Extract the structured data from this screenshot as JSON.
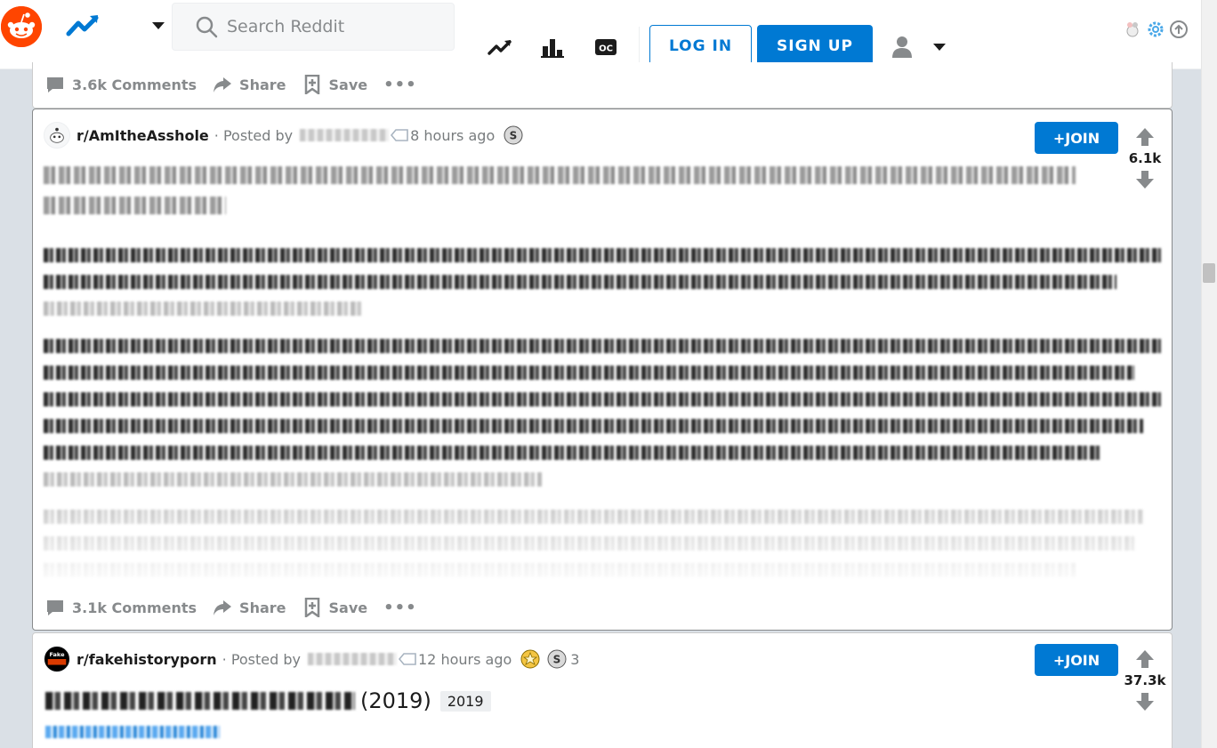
{
  "header": {
    "search_placeholder": "Search Reddit",
    "login_label": "LOG IN",
    "signup_label": "SIGN UP",
    "icons": [
      "reddit-logo",
      "trending-icon",
      "popular-icon",
      "oc-icon",
      "user-icon"
    ]
  },
  "posts": [
    {
      "comments_label": "3.6k Comments",
      "share_label": "Share",
      "save_label": "Save",
      "more_label": "•••"
    },
    {
      "subreddit": "r/AmItheAsshole",
      "posted_by_label": "· Posted by",
      "time": "8 hours ago",
      "join_label": "+JOIN",
      "score": "6.1k",
      "comments_label": "3.1k Comments",
      "share_label": "Share",
      "save_label": "Save",
      "more_label": "•••"
    },
    {
      "subreddit": "r/fakehistoryporn",
      "posted_by_label": "· Posted by",
      "time": "12 hours ago",
      "award_count": "3",
      "join_label": "+JOIN",
      "score": "37.3k",
      "title_suffix": "(2019)",
      "flair": "2019"
    }
  ],
  "colors": {
    "accent": "#0079d3",
    "brand": "#ff4500",
    "page_bg": "#dae0e6"
  }
}
